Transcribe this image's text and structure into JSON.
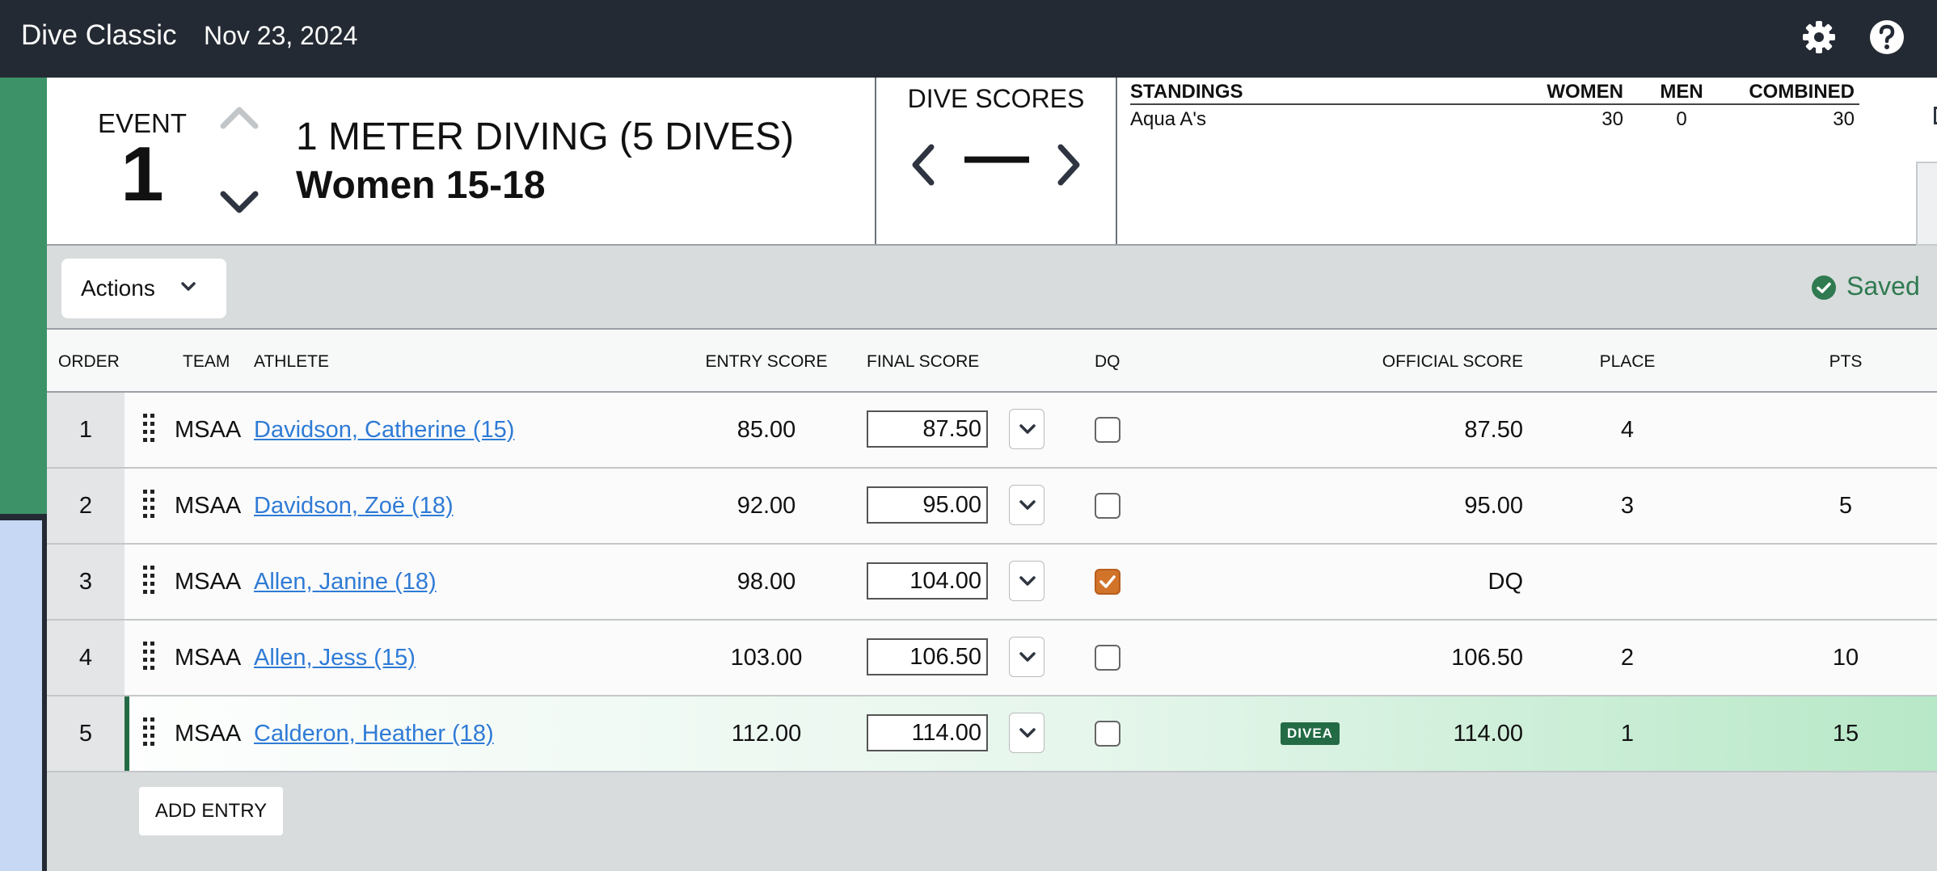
{
  "topbar": {
    "app_title": "Dive Classic",
    "date": "Nov 23, 2024"
  },
  "event": {
    "label": "EVENT",
    "number": "1",
    "title": "1 METER DIVING (5 DIVES)",
    "subtitle": "Women 15-18"
  },
  "dive_scores": {
    "title": "DIVE SCORES",
    "value": "—"
  },
  "standings": {
    "title": "STANDINGS",
    "columns": {
      "women": "WOMEN",
      "men": "MEN",
      "combined": "COMBINED"
    },
    "rows": [
      {
        "team": "Aqua A's",
        "women": "30",
        "men": "0",
        "combined": "30"
      }
    ]
  },
  "toolbar": {
    "actions_label": "Actions",
    "saved_label": "Saved"
  },
  "table": {
    "headers": {
      "order": "ORDER",
      "team": "TEAM",
      "athlete": "ATHLETE",
      "entry": "ENTRY SCORE",
      "final": "FINAL SCORE",
      "dq": "DQ",
      "official": "OFFICIAL SCORE",
      "place": "PLACE",
      "pts": "PTS"
    },
    "rows": [
      {
        "order": "1",
        "team": "MSAA",
        "athlete": "Davidson, Catherine (15)",
        "entry": "85.00",
        "final": "87.50",
        "dq": false,
        "official": "87.50",
        "place": "4",
        "pts": ""
      },
      {
        "order": "2",
        "team": "MSAA",
        "athlete": "Davidson, Zoë (18)",
        "entry": "92.00",
        "final": "95.00",
        "dq": false,
        "official": "95.00",
        "place": "3",
        "pts": "5"
      },
      {
        "order": "3",
        "team": "MSAA",
        "athlete": "Allen, Janine (18)",
        "entry": "98.00",
        "final": "104.00",
        "dq": true,
        "official": "DQ",
        "place": "",
        "pts": ""
      },
      {
        "order": "4",
        "team": "MSAA",
        "athlete": "Allen, Jess (15)",
        "entry": "103.00",
        "final": "106.50",
        "dq": false,
        "official": "106.50",
        "place": "2",
        "pts": "10"
      },
      {
        "order": "5",
        "team": "MSAA",
        "athlete": "Calderon, Heather (18)",
        "entry": "112.00",
        "final": "114.00",
        "dq": false,
        "badge": "DIVEA",
        "official": "114.00",
        "place": "1",
        "pts": "15"
      }
    ]
  },
  "add_entry_label": "ADD ENTRY",
  "colors": {
    "topbar": "#242a33",
    "rail": "#3d9268",
    "accent": "#236b45",
    "link": "#2f7bd6",
    "dq_checked": "#d2732a"
  },
  "icons": [
    "gear-icon",
    "help-icon",
    "chevron-up-icon",
    "chevron-down-icon",
    "chevron-left-icon",
    "chevron-right-icon",
    "podium-icon",
    "book-icon",
    "check-circle-icon",
    "drag-handle-icon",
    "checkmark-icon"
  ]
}
